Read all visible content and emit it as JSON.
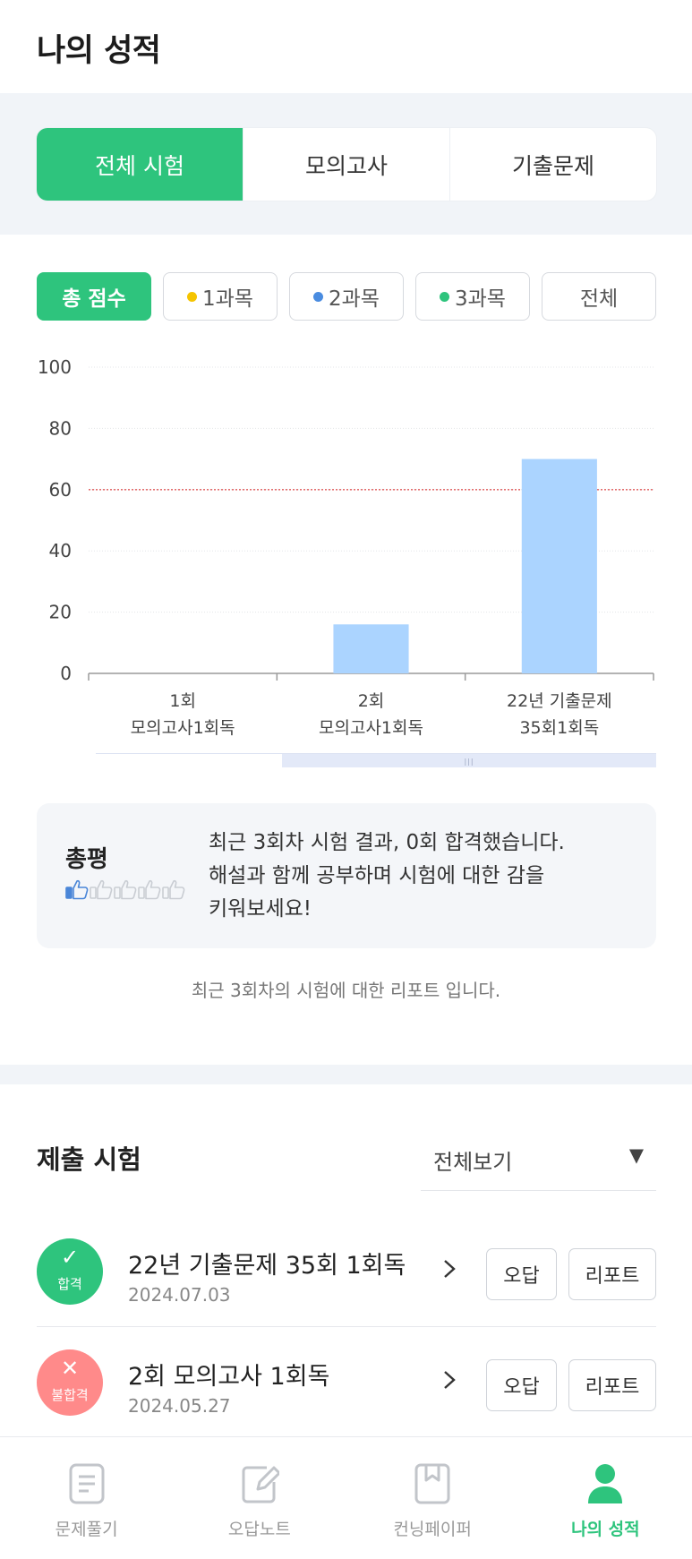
{
  "header": {
    "title": "나의 성적"
  },
  "tabs": [
    {
      "label": "전체 시험",
      "active": true
    },
    {
      "label": "모의고사",
      "active": false
    },
    {
      "label": "기출문제",
      "active": false
    }
  ],
  "filters": [
    {
      "label": "총 점수",
      "active": true,
      "dot": ""
    },
    {
      "label": "1과목",
      "active": false,
      "dot": "#f5c400"
    },
    {
      "label": "2과목",
      "active": false,
      "dot": "#4a8ce0"
    },
    {
      "label": "3과목",
      "active": false,
      "dot": "#2ec47d"
    },
    {
      "label": "전체",
      "active": false,
      "dot": ""
    }
  ],
  "chart_data": {
    "type": "bar",
    "categories": [
      [
        "1회",
        "모의고사1회독"
      ],
      [
        "2회",
        "모의고사1회독"
      ],
      [
        "22년 기출문제",
        "35회1회독"
      ]
    ],
    "values": [
      0,
      16,
      70
    ],
    "yticks": [
      0,
      20,
      40,
      60,
      80,
      100
    ],
    "ylim": [
      0,
      100
    ],
    "pass_line": 60,
    "bar_color": "#abd4ff",
    "pass_line_color": "#e05a5a",
    "grid": true
  },
  "review": {
    "title": "총평",
    "rating": 1,
    "rating_max": 5,
    "message": [
      "최근 3회차 시험 결과, 0회 합격했습니다.",
      "해설과 함께 공부하며 시험에 대한 감을",
      "키워보세요!"
    ]
  },
  "caption": "최근 3회차의 시험에 대한 리포트 입니다.",
  "submitted": {
    "title": "제출 시험",
    "filter_value": "전체보기",
    "wrong_label": "오답",
    "report_label": "리포트",
    "items": [
      {
        "name": "22년 기출문제 35회 1회독",
        "date": "2024.07.03",
        "status": "합격",
        "mark": "✓",
        "color": "#2ec47d"
      },
      {
        "name": "2회 모의고사 1회독",
        "date": "2024.05.27",
        "status": "불합격",
        "mark": "✕",
        "color": "#ff8a8a"
      }
    ]
  },
  "nav": [
    {
      "label": "문제풀기",
      "icon": "document-icon",
      "active": false
    },
    {
      "label": "오답노트",
      "icon": "edit-note-icon",
      "active": false
    },
    {
      "label": "컨닝페이퍼",
      "icon": "bookmark-book-icon",
      "active": false
    },
    {
      "label": "나의 성적",
      "icon": "person-icon",
      "active": true
    }
  ],
  "colors": {
    "accent": "#2ec47d",
    "fail": "#ff8a8a",
    "bg_section": "#f1f4f8"
  }
}
